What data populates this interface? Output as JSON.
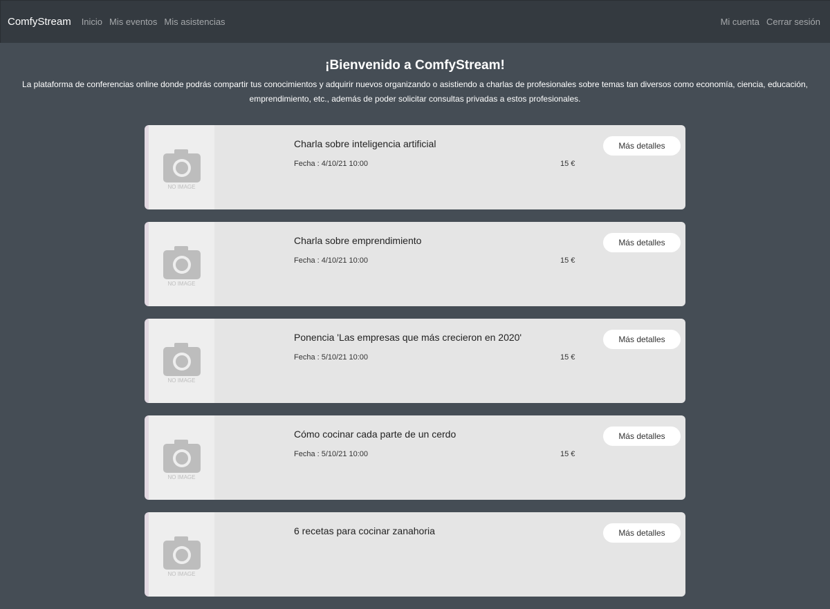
{
  "navbar": {
    "brand": "ComfyStream",
    "left_links": [
      "Inicio",
      "Mis eventos",
      "Mis asistencias"
    ],
    "right_links": [
      "Mi cuenta",
      "Cerrar sesión"
    ]
  },
  "hero": {
    "title": "¡Bienvenido a ComfyStream!",
    "text": "La plataforma de conferencias online donde podrás compartir tus conocimientos y adquirir nuevos organizando o asistiendo a charlas de profesionales sobre temas tan diversos como economía, ciencia, educación, emprendimiento, etc., además de poder solicitar consultas privadas a estos profesionales."
  },
  "no_image_label": "NO IMAGE",
  "events": [
    {
      "title": "Charla sobre inteligencia artificial",
      "date": "Fecha : 4/10/21 10:00",
      "price": "15 €",
      "button": "Más detalles"
    },
    {
      "title": "Charla sobre emprendimiento",
      "date": "Fecha : 4/10/21 10:00",
      "price": "15 €",
      "button": "Más detalles"
    },
    {
      "title": "Ponencia 'Las empresas que más crecieron en 2020'",
      "date": "Fecha : 5/10/21 10:00",
      "price": "15 €",
      "button": "Más detalles"
    },
    {
      "title": "Cómo cocinar cada parte de un cerdo",
      "date": "Fecha : 5/10/21 10:00",
      "price": "15 €",
      "button": "Más detalles"
    },
    {
      "title": "6 recetas para cocinar zanahoria",
      "date": "",
      "price": "",
      "button": "Más detalles"
    }
  ],
  "icons": {
    "placeholder": "camera-icon"
  },
  "colors": {
    "page_bg": "#454d55",
    "navbar_bg": "#343a40",
    "card_bg": "#e5e5e5"
  }
}
